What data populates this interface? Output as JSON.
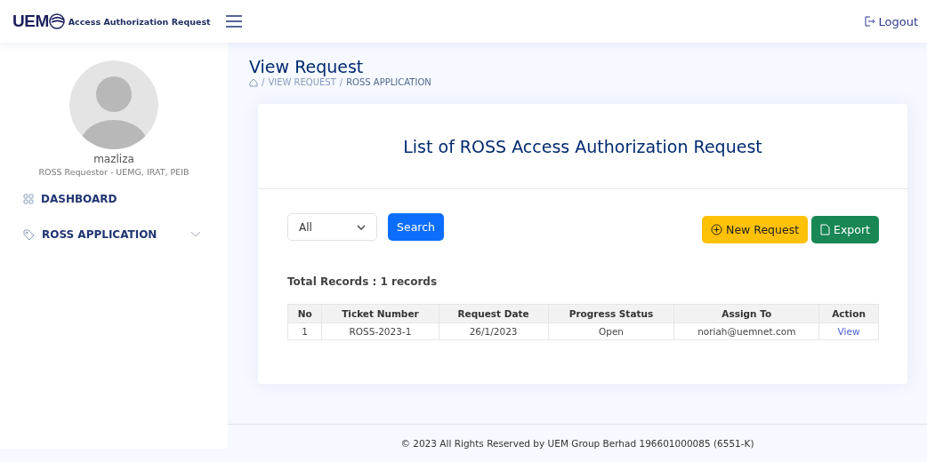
{
  "header": {
    "logo": "UEM",
    "app_title": "Access Authorization Request",
    "logout": "Logout"
  },
  "sidebar": {
    "user": {
      "name": "mazliza",
      "role": "ROSS Requestor - UEMG, IRAT, PEIB"
    },
    "items": [
      {
        "label": "DASHBOARD",
        "kind": "grid",
        "expandable": false
      },
      {
        "label": "ROSS APPLICATION",
        "kind": "tag",
        "expandable": true
      }
    ]
  },
  "page": {
    "title": "View Request",
    "breadcrumb": [
      {
        "kind": "separator",
        "text": "/"
      },
      {
        "kind": "link",
        "text": "VIEW REQUEST"
      },
      {
        "kind": "separator",
        "text": "/"
      },
      {
        "kind": "current",
        "text": "ROSS APPLICATION"
      }
    ]
  },
  "card": {
    "title": "List of ROSS Access Authorization Request",
    "filter": {
      "value": "All"
    },
    "search_button": "Search",
    "new_button": "New Request",
    "export_button": "Export",
    "total": "Total Records : 1 records",
    "table": {
      "columns": [
        "No",
        "Ticket Number",
        "Request Date",
        "Progress Status",
        "Assign To",
        "Action"
      ],
      "rows": [
        [
          "1",
          "ROSS-2023-1",
          "26/1/2023",
          "Open",
          "noriah@uemnet.com",
          "View"
        ]
      ]
    }
  },
  "footer": "© 2023 All Rights Reserved by UEM Group Berhad 196601000085 (6551-K)"
}
